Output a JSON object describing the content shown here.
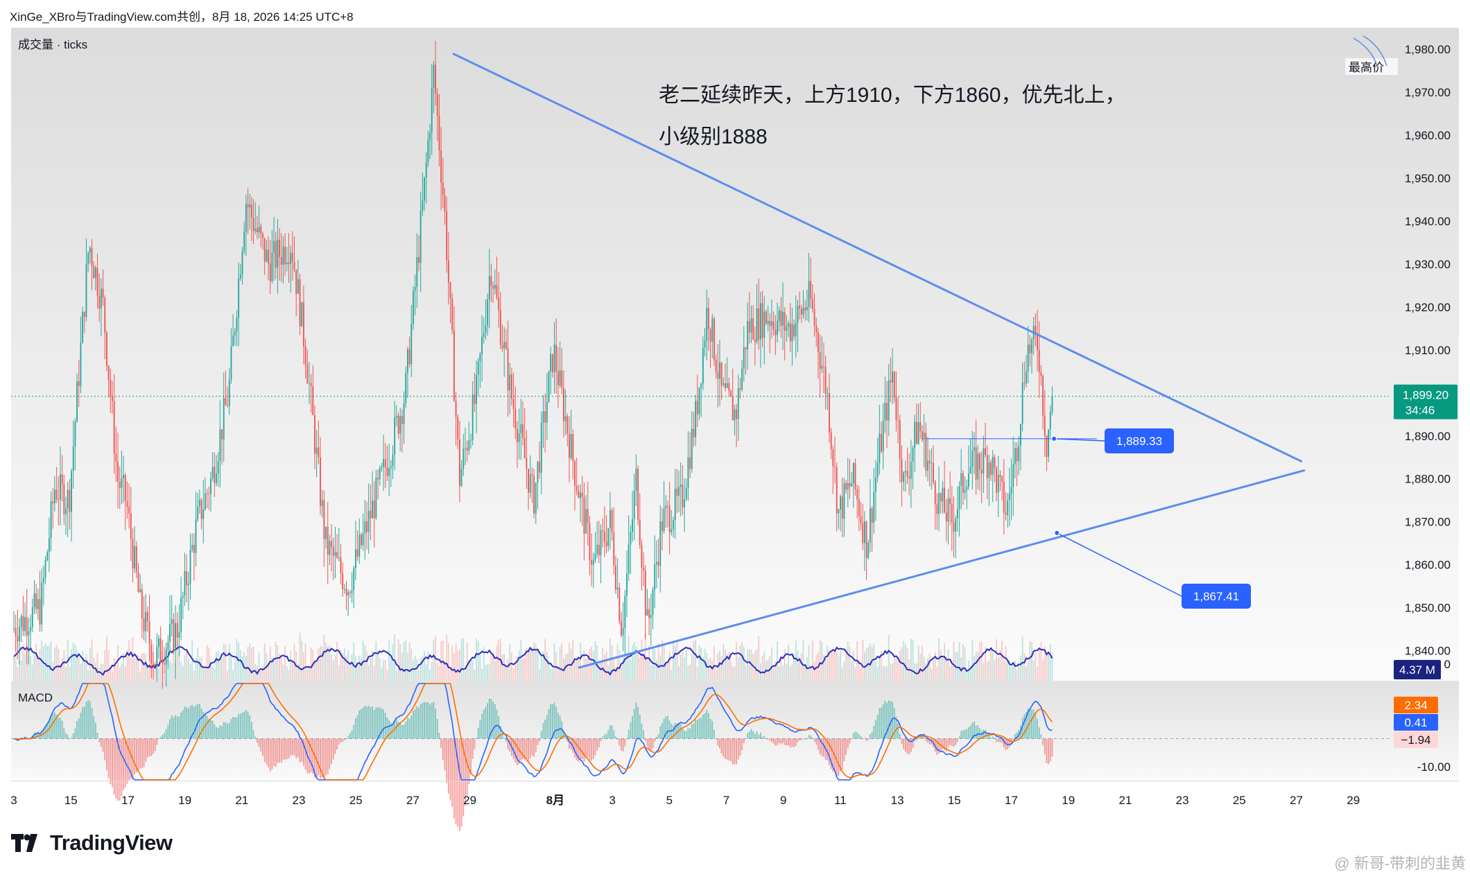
{
  "header": {
    "attribution": "XinGe_XBro与TradingView.com共创，8月 18, 2026 14:25 UTC+8"
  },
  "volume_label": "成交量 · ticks",
  "macd_label": "MACD",
  "annotations": {
    "line1": "老二延续昨天，上方1910，下方1860，优先北上，",
    "line2": "小级别1888"
  },
  "price_axis": {
    "ticks": [
      "1,980.00",
      "1,970.00",
      "1,960.00",
      "1,950.00",
      "1,940.00",
      "1,930.00",
      "1,920.00",
      "1,910.00",
      "1,900.00",
      "1,890.00",
      "1,880.00",
      "1,870.00",
      "1,860.00",
      "1,850.00",
      "1,840.00"
    ],
    "tick_values": [
      1980,
      1970,
      1960,
      1950,
      1940,
      1930,
      1920,
      1910,
      1900,
      1890,
      1880,
      1870,
      1860,
      1850,
      1840
    ],
    "high_label": "最高价",
    "current_price": "1,899.20",
    "countdown": "34:46",
    "volume_badge": "4.37 M",
    "partial_tick": "0"
  },
  "macd_axis": {
    "ticks": [
      "-10.00"
    ],
    "macd_badge": "2.34",
    "signal_badge": "0.41",
    "hist_badge": "−1.94"
  },
  "time_axis": {
    "labels": [
      "3",
      "15",
      "17",
      "19",
      "21",
      "23",
      "25",
      "27",
      "29",
      "8月",
      "3",
      "5",
      "7",
      "9",
      "11",
      "13",
      "15",
      "17",
      "19",
      "21",
      "23",
      "25",
      "27",
      "29"
    ]
  },
  "callouts": {
    "upper": "1,889.33",
    "lower": "1,867.41"
  },
  "brand": {
    "name": "TradingView",
    "watermark": "@ 新哥-带刺的韭黄"
  },
  "colors": {
    "up": "#26a69a",
    "down": "#ef5350",
    "trendline": "#5b8def",
    "badge_blue": "#2962ff",
    "current_price": "#089981",
    "macd_line": "#2962ff",
    "signal_line": "#ff6d00",
    "volume_ma": "#2a2fb8"
  },
  "chart_data": {
    "type": "candlestick",
    "y_range": [
      1833,
      1985
    ],
    "x_range_days": [
      "Jul 13 2026",
      "Aug 30 2026"
    ],
    "price_path": {
      "description_free": true,
      "points": [
        [
          "Jul 13",
          1845
        ],
        [
          "Jul 14",
          1850
        ],
        [
          "Jul 14.5",
          1878
        ],
        [
          "Jul 15",
          1875
        ],
        [
          "Jul 15.7",
          1935
        ],
        [
          "Jul 16.2",
          1920
        ],
        [
          "Jul 16.7",
          1880
        ],
        [
          "Jul 17",
          1875
        ],
        [
          "Jul 17.5",
          1850
        ],
        [
          "Jul 18",
          1838
        ],
        [
          "Jul 18.8",
          1845
        ],
        [
          "Jul 19.5",
          1870
        ],
        [
          "Jul 20",
          1880
        ],
        [
          "Jul 20.6",
          1900
        ],
        [
          "Jul 21.2",
          1945
        ],
        [
          "Jul 22",
          1930
        ],
        [
          "Jul 22.8",
          1935
        ],
        [
          "Jul 23.3",
          1910
        ],
        [
          "Jul 24",
          1865
        ],
        [
          "Jul 24.8",
          1855
        ],
        [
          "Jul 25.5",
          1870
        ],
        [
          "Jul 26.2",
          1885
        ],
        [
          "Jul 26.8",
          1900
        ],
        [
          "Jul 27.5",
          1950
        ],
        [
          "Jul 27.8",
          1975
        ],
        [
          "Jul 28.2",
          1940
        ],
        [
          "Jul 28.7",
          1880
        ],
        [
          "Jul 29.3",
          1900
        ],
        [
          "Jul 29.8",
          1930
        ],
        [
          "Jul 30.5",
          1900
        ],
        [
          "Jul 31.3",
          1875
        ],
        [
          "Aug 1",
          1910
        ],
        [
          "Aug 1.8",
          1880
        ],
        [
          "Aug 2.4",
          1860
        ],
        [
          "Aug 3",
          1870
        ],
        [
          "Aug 3.4",
          1845
        ],
        [
          "Aug 3.9",
          1880
        ],
        [
          "Aug 4.3",
          1845
        ],
        [
          "Aug 4.8",
          1870
        ],
        [
          "Aug 5.5",
          1875
        ],
        [
          "Aug 6",
          1895
        ],
        [
          "Aug 6.4",
          1920
        ],
        [
          "Aug 6.9",
          1900
        ],
        [
          "Aug 7.4",
          1895
        ],
        [
          "Aug 7.8",
          1915
        ],
        [
          "Aug 8.5",
          1918
        ],
        [
          "Aug 9.3",
          1915
        ],
        [
          "Aug 10",
          1922
        ],
        [
          "Aug 10.6",
          1900
        ],
        [
          "Aug 11",
          1872
        ],
        [
          "Aug 11.5",
          1880
        ],
        [
          "Aug 12",
          1865
        ],
        [
          "Aug 12.4",
          1885
        ],
        [
          "Aug 12.9",
          1905
        ],
        [
          "Aug 13.3",
          1878
        ],
        [
          "Aug 13.8",
          1893
        ],
        [
          "Aug 14.5",
          1875
        ],
        [
          "Aug 15",
          1870
        ],
        [
          "Aug 15.5",
          1882
        ],
        [
          "Aug 16.3",
          1885
        ],
        [
          "Aug 16.9",
          1872
        ],
        [
          "Aug 17.3",
          1890
        ],
        [
          "Aug 17.6",
          1910
        ],
        [
          "Aug 18",
          1912
        ],
        [
          "Aug 18.3",
          1888
        ],
        [
          "Aug 18.5",
          1899.2
        ]
      ]
    },
    "current_price": 1899.2,
    "highest_visible": 1980,
    "trendlines": [
      {
        "from": [
          "Jul 28.4",
          1979
        ],
        "to": [
          "Aug 27.2",
          1884
        ]
      },
      {
        "from": [
          "Aug 1.8",
          1836
        ],
        "to": [
          "Aug 27.3",
          1882
        ]
      }
    ],
    "price_markers": [
      1889.33,
      1867.41
    ],
    "volume_last": "4.37 M",
    "macd": {
      "macd": 2.34,
      "signal": 0.41,
      "histogram": -1.94,
      "range": [
        -12,
        12
      ]
    }
  }
}
